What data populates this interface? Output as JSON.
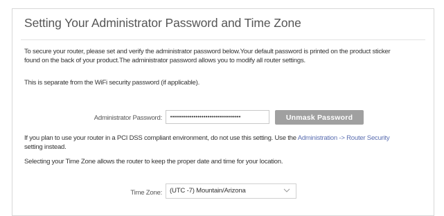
{
  "page": {
    "title": "Setting Your Administrator Password and Time Zone",
    "intro_line1": "To secure your router, please set and verify the administrator password below.Your default password is printed on the product sticker",
    "intro_line2": "found on the back of your product.The administrator password allows you to modify all router settings.",
    "wifi_note": "This is separate from the WiFi security password (if applicable).",
    "pci_line1_before": "If you plan to use your router in a PCI DSS compliant environment, do not use this setting. Use the ",
    "pci_link": "Administration -> Router Security",
    "pci_line2": "setting instead.",
    "timezone_note": "Selecting your Time Zone allows the router to keep the proper date and time for your location."
  },
  "password": {
    "label": "Administrator Password:",
    "value": "••••••••••••••••••••••••••••••••••••",
    "unmask_label": "Unmask Password"
  },
  "timezone": {
    "label": "Time Zone:",
    "selected": "(UTC -7) Mountain/Arizona",
    "icon": "chevron-down-icon"
  },
  "colors": {
    "link": "#5c6fb1",
    "button_bg": "#a0a0a0",
    "border": "#d7d7d7"
  }
}
